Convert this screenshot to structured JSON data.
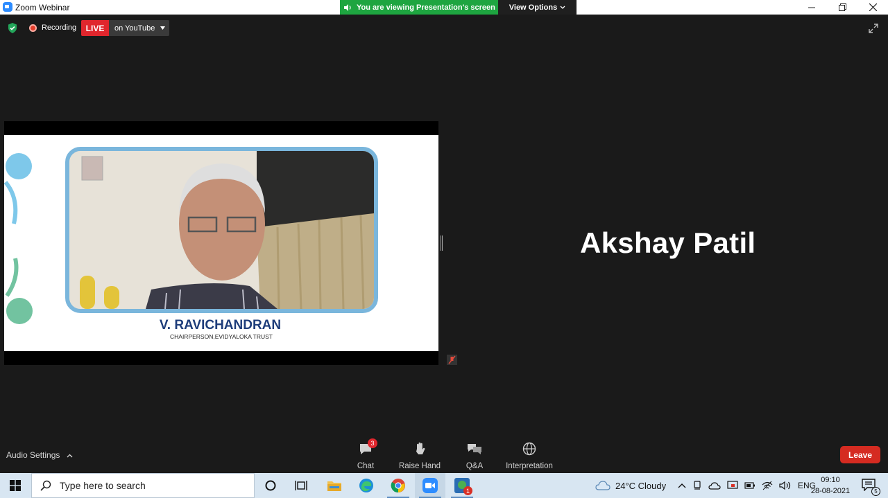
{
  "window": {
    "title": "Zoom Webinar"
  },
  "banner": {
    "viewing_text": "You are viewing Presentation's screen",
    "view_options_label": "View Options"
  },
  "toolbar": {
    "recording_label": "Recording",
    "live_label": "LIVE",
    "stream_target_label": "on YouTube"
  },
  "slide": {
    "speaker_name": "V. RAVICHANDRAN",
    "speaker_title": "CHAIRPERSON,EVIDYALOKA TRUST"
  },
  "participant": {
    "name": "Akshay Patil"
  },
  "bottom_bar": {
    "audio_settings_label": "Audio Settings",
    "controls": [
      {
        "label": "Chat",
        "icon": "chat-icon",
        "badge": "3"
      },
      {
        "label": "Raise Hand",
        "icon": "hand-icon"
      },
      {
        "label": "Q&A",
        "icon": "qa-icon"
      },
      {
        "label": "Interpretation",
        "icon": "globe-icon"
      }
    ],
    "leave_label": "Leave"
  },
  "taskbar": {
    "search_placeholder": "Type here to search",
    "weather": "24°C  Cloudy",
    "language": "ENG",
    "time": "09:10",
    "date": "28-08-2021",
    "app_badge": "1",
    "notification_count": "5"
  },
  "colors": {
    "live_red": "#e0262d",
    "banner_green": "#1ea540",
    "leave_red": "#d52b21",
    "slide_name_blue": "#1e3d7a",
    "frame_blue": "#7ab6dc"
  }
}
